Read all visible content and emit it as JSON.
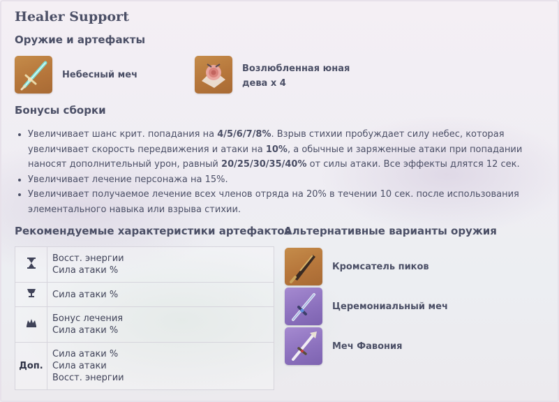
{
  "title": "Healer Support",
  "weapons_artifacts": {
    "heading": "Оружие и артефакты",
    "weapon": {
      "icon": "sword-icon",
      "name": "Небесный меч"
    },
    "artifact": {
      "icon": "rose-artifact-icon",
      "name_line1": "Возлюбленная юная",
      "name_line2": "дева x 4"
    }
  },
  "bonuses": {
    "heading": "Бонусы сборки",
    "items": [
      {
        "parts": [
          {
            "t": "Увеличивает шанс крит. попадания на ",
            "b": false
          },
          {
            "t": "4/5/6/7/8%",
            "b": true
          },
          {
            "t": ". Взрыв стихии пробуждает силу небес, которая увеличивает скорость передвижения и атаки на ",
            "b": false
          },
          {
            "t": "10%",
            "b": true
          },
          {
            "t": ", а обычные и заряженные атаки при попадании наносят дополнительный урон, равный ",
            "b": false
          },
          {
            "t": "20/25/30/35/40%",
            "b": true
          },
          {
            "t": " от силы атаки. Все эффекты длятся 12 сек.",
            "b": false
          }
        ]
      },
      {
        "parts": [
          {
            "t": "Увеличивает лечение персонажа на 15%.",
            "b": false
          }
        ]
      },
      {
        "parts": [
          {
            "t": "Увеличивает получаемое лечение всех членов отряда на 20% в течении 10 сек. после использования элементального навыка или взрыва стихии.",
            "b": false
          }
        ]
      }
    ]
  },
  "stats": {
    "heading": "Рекомендуемые характеристики артефактов",
    "rows": [
      {
        "slot_icon": "hourglass-icon",
        "values": [
          "Восст. энергии",
          "Сила атаки %"
        ]
      },
      {
        "slot_icon": "goblet-icon",
        "values": [
          "Сила атаки %"
        ]
      },
      {
        "slot_icon": "circlet-icon",
        "values": [
          "Бонус лечения",
          "Сила атаки %"
        ]
      },
      {
        "slot_label": "Доп.",
        "values": [
          "Сила атаки %",
          "Сила атаки",
          "Восст. энергии"
        ]
      }
    ]
  },
  "alt_weapons": {
    "heading": "Альтернативные варианты оружия",
    "items": [
      {
        "icon": "summit-shaper-sword-icon",
        "name": "Кромсатель пиков",
        "rarity_color": "#b8793d"
      },
      {
        "icon": "ceremonial-sword-icon",
        "name": "Церемониальный меч",
        "rarity_color": "#8c72be"
      },
      {
        "icon": "favonius-sword-icon",
        "name": "Меч Фавония",
        "rarity_color": "#8c72be"
      }
    ]
  },
  "colors": {
    "text": "#4b4f66",
    "gold_rarity": "#b8793d",
    "purple_rarity": "#8c72be",
    "border": "#d6d4dc"
  }
}
